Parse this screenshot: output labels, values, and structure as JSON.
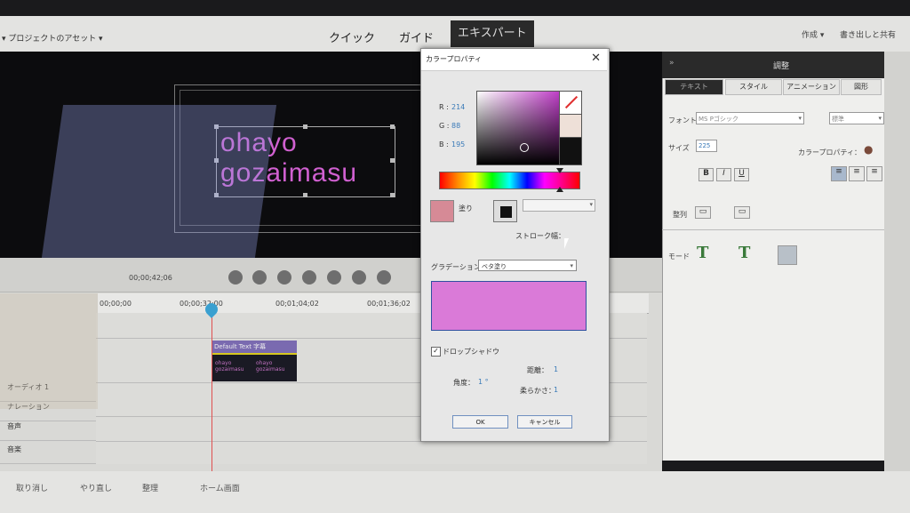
{
  "topbar": {
    "project_menu": "▾ プロジェクトのアセット ▾",
    "modes": [
      "クイック",
      "ガイド",
      "エキスパート"
    ],
    "right_a": "作成 ▾",
    "right_b": "書き出しと共有"
  },
  "monitor": {
    "title_text_line1": "ohayo",
    "title_text_line2": "gozaimasu"
  },
  "timeline": {
    "current_time": "00;00;42;06",
    "ruler_labels": [
      "00;00;00",
      "00;00;32;00",
      "00;01;04;02",
      "00;01;36;02"
    ],
    "track_labels": [
      "オーディオ 1",
      "ナレーション",
      "音声",
      "音楽"
    ],
    "clip_name": "Default Text 字幕",
    "clip_text_a": "ohayo gozaimasu",
    "clip_text_b": "ohayo gozaimasu"
  },
  "bottombar": {
    "items": [
      "取り消し",
      "やり直し",
      "整理",
      "ホーム画面"
    ]
  },
  "right_panel": {
    "header": "調整",
    "tabs": [
      "テキスト",
      "スタイル",
      "アニメーション",
      "図形"
    ],
    "font_label": "フォント",
    "font_value": "MS Pゴシック",
    "style_value": "標準",
    "size_label": "サイズ",
    "size_value": "225",
    "color_label": "カラープロパティ：",
    "bold": "B",
    "italic": "I",
    "underline": "U",
    "align_label": "整列",
    "mode_label": "モード"
  },
  "dialog": {
    "title": "カラープロパティ",
    "close": "✕",
    "r_label": "R :",
    "r_value": "214",
    "g_label": "G :",
    "g_value": "88",
    "b_label": "B :",
    "b_value": "195",
    "fill_label": "塗り",
    "stroke_width_label": "ストローク幅：",
    "gradient_label": "グラデーション",
    "gradient_value": "ベタ塗り",
    "drop_shadow_label": "ドロップシャドウ",
    "distance_label": "距離：",
    "distance_value": "1",
    "angle_label": "角度：",
    "angle_value": "1 °",
    "softness_label": "柔らかさ：",
    "softness_value": "1",
    "ok": "OK",
    "cancel": "キャンセル",
    "colors": {
      "current": "#da7ad8",
      "fill_swatch": "#d68a96"
    }
  }
}
